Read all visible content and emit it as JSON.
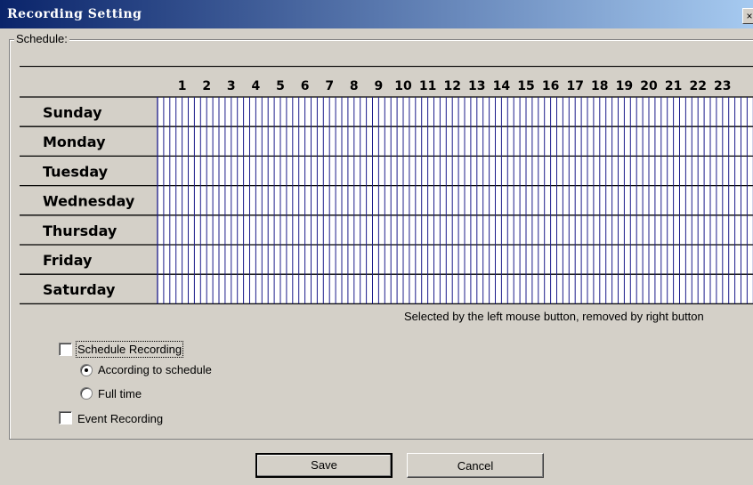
{
  "window": {
    "title": "Recording Setting",
    "close_label": "×"
  },
  "schedule": {
    "group_label": "Schedule:",
    "hours": [
      "1",
      "2",
      "3",
      "4",
      "5",
      "6",
      "7",
      "8",
      "9",
      "10",
      "11",
      "12",
      "13",
      "14",
      "15",
      "16",
      "17",
      "18",
      "19",
      "20",
      "21",
      "22",
      "23"
    ],
    "days": [
      "Sunday",
      "Monday",
      "Tuesday",
      "Wednesday",
      "Thursday",
      "Friday",
      "Saturday"
    ],
    "hint": "Selected by the left mouse button, removed by right button"
  },
  "options": {
    "schedule_recording": {
      "label": "Schedule Recording",
      "checked": false
    },
    "according_to_schedule": {
      "label": "According to schedule",
      "selected": true
    },
    "full_time": {
      "label": "Full time",
      "selected": false
    },
    "event_recording": {
      "label": "Event Recording",
      "checked": false
    }
  },
  "buttons": {
    "save": "Save",
    "cancel": "Cancel"
  }
}
